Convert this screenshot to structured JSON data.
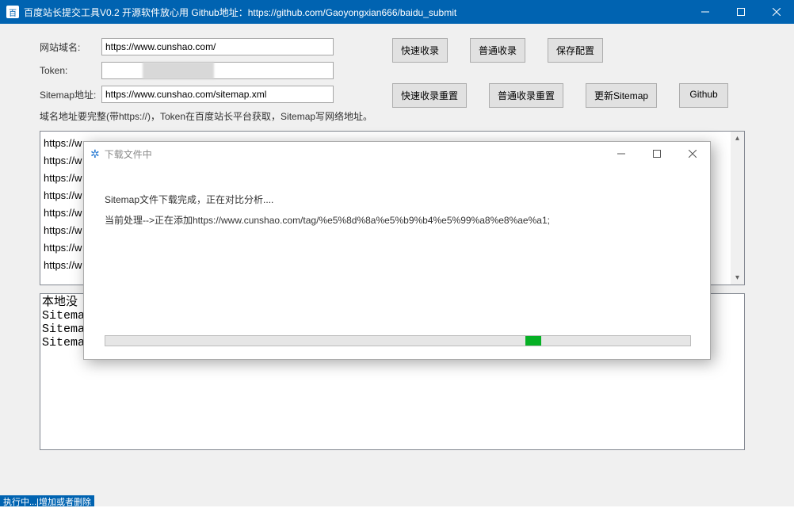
{
  "titlebar": {
    "text": "百度站长提交工具V0.2 开源软件放心用 Github地址：https://github.com/Gaoyongxian666/baidu_submit"
  },
  "form": {
    "domain_label": "网站域名:",
    "domain_value": "https://www.cunshao.com/",
    "token_label": "Token:",
    "token_value": "",
    "sitemap_label": "Sitemap地址:",
    "sitemap_value": "https://www.cunshao.com/sitemap.xml",
    "hint": "域名地址要完整(带https://)，Token在百度站长平台获取，Sitemap写网络地址。"
  },
  "buttons": {
    "fast_include": "快速收录",
    "normal_include": "普通收录",
    "save_config": "保存配置",
    "fast_reset": "快速收录重置",
    "normal_reset": "普通收录重置",
    "update_sitemap": "更新Sitemap",
    "github": "Github"
  },
  "log1": {
    "lines": [
      "",
      "https://w",
      "https://w",
      "https://w",
      "https://w",
      "https://w",
      "https://w",
      "https://w",
      "https://w"
    ]
  },
  "log2": {
    "lines": [
      "本地没",
      "Sitema",
      "Sitemap线程-->下载Sitemap.xml完成,正在解析xml文件...",
      "Sitemap线程-->本地删除[]"
    ]
  },
  "statusbar": "执行中...|增加或者删除",
  "modal": {
    "title": "下载文件中",
    "line1": "Sitemap文件下载完成，正在对比分析....",
    "line2": "当前处理-->正在添加https://www.cunshao.com/tag/%e5%8d%8a%e5%b9%b4%e5%99%a8%e8%ae%a1;"
  }
}
